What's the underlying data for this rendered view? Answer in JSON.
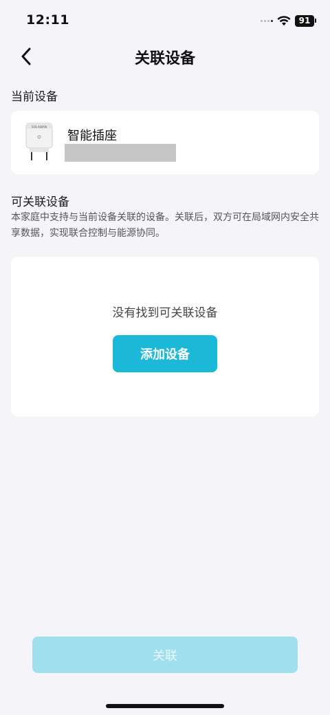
{
  "status_bar": {
    "time": "12:11",
    "battery": "91"
  },
  "nav": {
    "title": "关联设备"
  },
  "current_device": {
    "section_label": "当前设备",
    "name": "智能插座",
    "product_brand": "SOLAWAN"
  },
  "linkable": {
    "section_label": "可关联设备",
    "description": "本家庭中支持与当前设备关联的设备。关联后，双方可在局域网内安全共享数据，实现联合控制与能源协同。",
    "empty_text": "没有找到可关联设备",
    "add_button": "添加设备"
  },
  "footer": {
    "link_button": "关联"
  },
  "colors": {
    "accent": "#1bb8d7",
    "accent_disabled": "#9fdfee",
    "background": "#f5f5f9"
  }
}
